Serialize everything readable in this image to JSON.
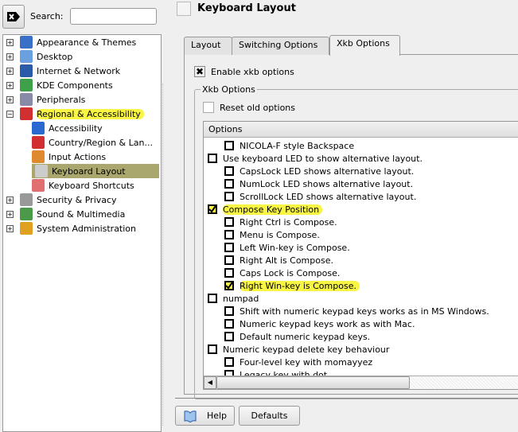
{
  "search": {
    "label": "Search:",
    "value": ""
  },
  "tree": [
    {
      "label": "Appearance & Themes",
      "expander": "+",
      "icon": "appearance-icon",
      "color": "#3a6fc8"
    },
    {
      "label": "Desktop",
      "expander": "+",
      "icon": "desktop-icon",
      "color": "#6aa0e0"
    },
    {
      "label": "Internet & Network",
      "expander": "+",
      "icon": "globe-icon",
      "color": "#2a5aa8"
    },
    {
      "label": "KDE Components",
      "expander": "+",
      "icon": "components-icon",
      "color": "#3fa04a"
    },
    {
      "label": "Peripherals",
      "expander": "+",
      "icon": "peripherals-icon",
      "color": "#888aa8"
    },
    {
      "label": "Regional & Accessibility",
      "expander": "−",
      "icon": "flags-icon",
      "color": "#d23030",
      "highlight": true
    },
    {
      "label": "Accessibility",
      "child": true,
      "icon": "wheelchair-icon",
      "color": "#2a6ad0"
    },
    {
      "label": "Country/Region & Lan...",
      "child": true,
      "icon": "flags-icon",
      "color": "#d23030"
    },
    {
      "label": "Input Actions",
      "child": true,
      "icon": "keyboard-icon",
      "color": "#e08a30"
    },
    {
      "label": "Keyboard Layout",
      "child": true,
      "icon": "keyboard-layout-icon",
      "color": "#cccccc",
      "selected": true
    },
    {
      "label": "Keyboard Shortcuts",
      "child": true,
      "icon": "keyboard-shortcuts-icon",
      "color": "#e07070"
    },
    {
      "label": "Security & Privacy",
      "expander": "+",
      "icon": "keys-icon",
      "color": "#999999"
    },
    {
      "label": "Sound & Multimedia",
      "expander": "+",
      "icon": "speaker-icon",
      "color": "#4a9a4a"
    },
    {
      "label": "System Administration",
      "expander": "+",
      "icon": "gears-icon",
      "color": "#e0a020"
    }
  ],
  "title": "Keyboard Layout",
  "tabs": [
    {
      "label": "Layout"
    },
    {
      "label": "Switching Options"
    },
    {
      "label": "Xkb Options",
      "active": true
    }
  ],
  "enable_xkb": {
    "label": "Enable xkb options",
    "checked": true
  },
  "group_title": "Xkb Options",
  "reset_old": {
    "label": "Reset old options",
    "checked": false
  },
  "list_header": "Options",
  "options": [
    {
      "label": "NICOLA-F style Backspace",
      "level": 1,
      "checked": false
    },
    {
      "label": "Use keyboard LED to show alternative layout.",
      "level": 0,
      "checked": false
    },
    {
      "label": "CapsLock LED shows alternative layout.",
      "level": 1,
      "checked": false
    },
    {
      "label": "NumLock LED shows alternative layout.",
      "level": 1,
      "checked": false
    },
    {
      "label": "ScrollLock LED shows alternative layout.",
      "level": 1,
      "checked": false
    },
    {
      "label": "Compose Key Position",
      "level": 0,
      "checked": true,
      "highlight": true
    },
    {
      "label": "Right Ctrl is Compose.",
      "level": 1,
      "checked": false
    },
    {
      "label": "Menu is Compose.",
      "level": 1,
      "checked": false
    },
    {
      "label": "Left Win-key is Compose.",
      "level": 1,
      "checked": false
    },
    {
      "label": "Right Alt is Compose.",
      "level": 1,
      "checked": false
    },
    {
      "label": "Caps Lock is Compose.",
      "level": 1,
      "checked": false
    },
    {
      "label": "Right Win-key is Compose.",
      "level": 1,
      "checked": true,
      "highlight": true
    },
    {
      "label": "numpad",
      "level": 0,
      "checked": false
    },
    {
      "label": "Shift with numeric keypad keys works as in MS Windows.",
      "level": 1,
      "checked": false
    },
    {
      "label": "Numeric keypad keys work as with Mac.",
      "level": 1,
      "checked": false
    },
    {
      "label": "Default numeric keypad keys.",
      "level": 1,
      "checked": false
    },
    {
      "label": "Numeric keypad delete key behaviour",
      "level": 0,
      "checked": false
    },
    {
      "label": "Four-level key with momayyez",
      "level": 1,
      "checked": false
    },
    {
      "label": "Legacy key with dot",
      "level": 1,
      "checked": false
    }
  ],
  "buttons": {
    "help": "Help",
    "defaults": "Defaults"
  },
  "colors": {
    "selection": "#a9a66e",
    "highlight": "#f8f545"
  }
}
